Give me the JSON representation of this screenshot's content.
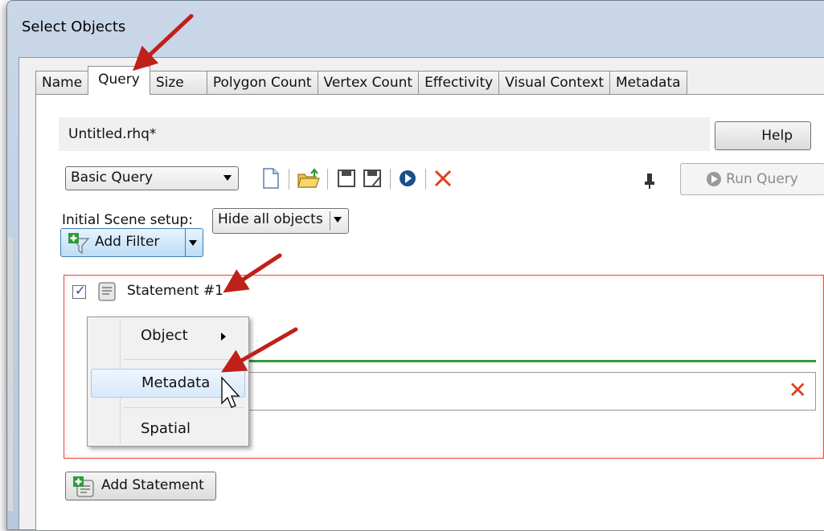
{
  "window": {
    "title": "Select Objects"
  },
  "tabs": [
    {
      "label": "Name",
      "active": false
    },
    {
      "label": "Query",
      "active": true
    },
    {
      "label": "Size",
      "active": false
    },
    {
      "label": "Polygon Count",
      "active": false
    },
    {
      "label": "Vertex Count",
      "active": false
    },
    {
      "label": "Effectivity",
      "active": false
    },
    {
      "label": "Visual Context",
      "active": false
    },
    {
      "label": "Metadata",
      "active": false
    }
  ],
  "query": {
    "file_name": "Untitled.rhq*",
    "help_label": "Help",
    "type_value": "Basic Query",
    "run_label": "Run Query",
    "scene_setup_label": "Initial Scene setup:",
    "scene_setup_value": "Hide all objects"
  },
  "statement": {
    "label": "Statement #1",
    "checked": true,
    "add_filter_label": "Add Filter",
    "add_statement_label": "Add Statement"
  },
  "menu": {
    "items": [
      {
        "label": "Object",
        "has_submenu": true,
        "highlighted": false
      },
      {
        "label": "Metadata",
        "has_submenu": false,
        "highlighted": true
      },
      {
        "label": "Spatial",
        "has_submenu": false,
        "highlighted": false
      }
    ]
  },
  "colors": {
    "annotation_arrow": "#c0201a",
    "delete_red": "#e23c1c",
    "statement_border": "#e05050",
    "filter_line": "#2f9a3a",
    "add_filter_bg": "#bcdcf5"
  }
}
